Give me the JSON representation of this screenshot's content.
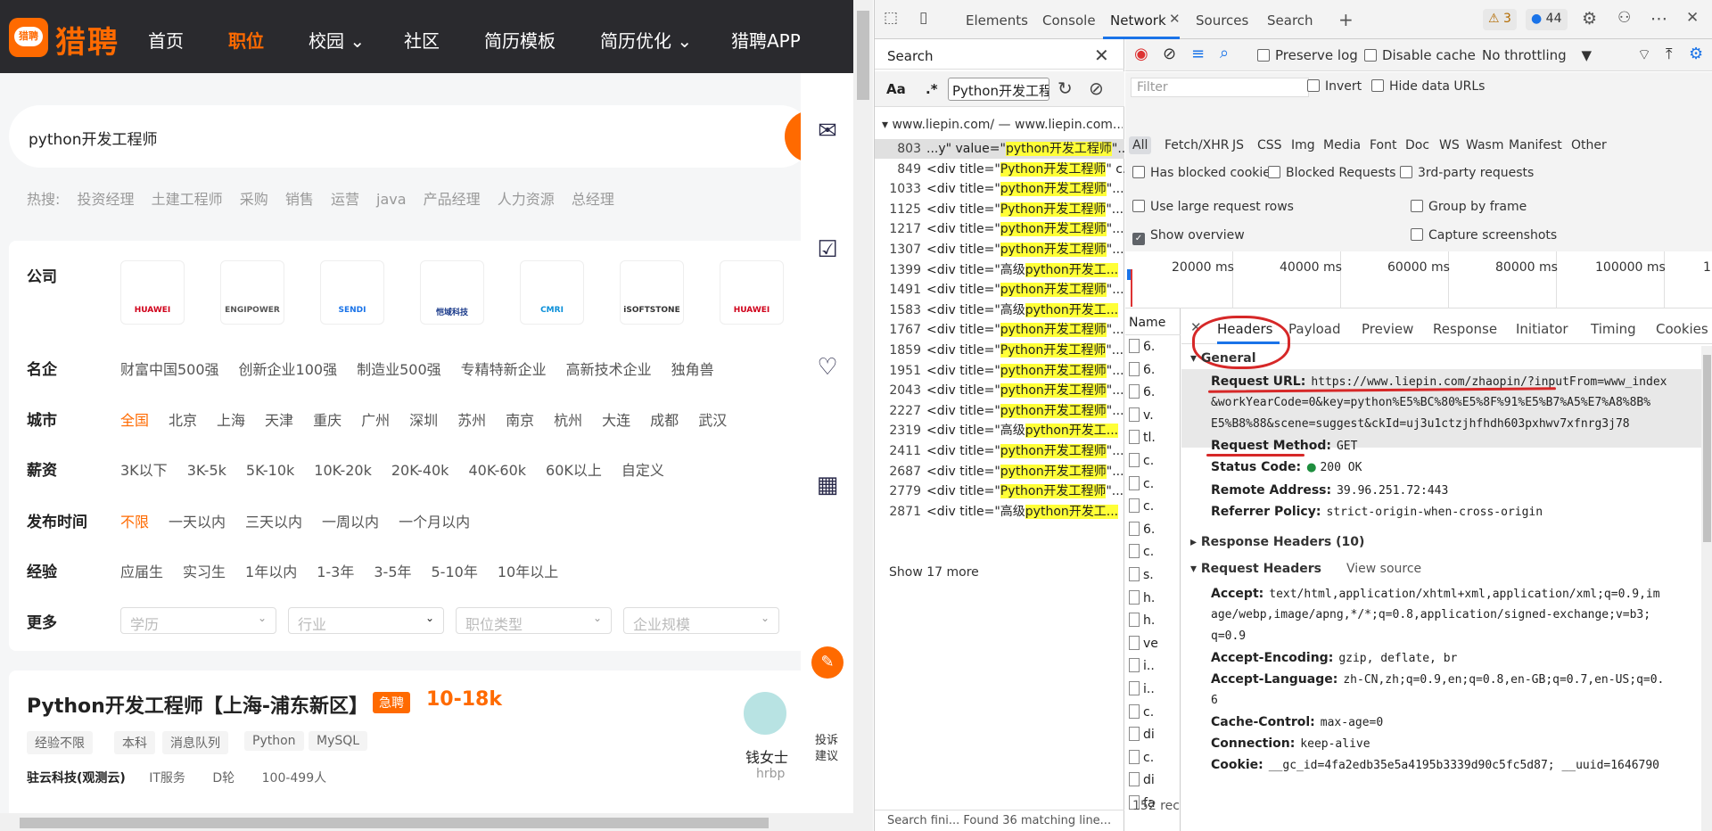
{
  "site": {
    "logo_badge": "猎聘",
    "logo_text": "猎聘",
    "nav": [
      "首页",
      "职位",
      "校园 ⌄",
      "社区",
      "简历模板",
      "简历优化 ⌄",
      "猎聘APP"
    ],
    "search_value": "python开发工程师",
    "hot_label": "热搜:",
    "hot_terms": [
      "投资经理",
      "土建工程师",
      "采购",
      "销售",
      "运营",
      "java",
      "产品经理",
      "人力资源",
      "总经理"
    ],
    "filters": {
      "company_label": "公司",
      "company_logos": [
        "HUAWEI",
        "ENGIPOWER",
        "SENDI",
        "恺域科技",
        "CMRI",
        "iSOFTSTONE",
        "HUAWEI"
      ],
      "famous_label": "名企",
      "famous": [
        "财富中国500强",
        "创新企业100强",
        "制造业500强",
        "专精特新企业",
        "高新技术企业",
        "独角兽"
      ],
      "city_label": "城市",
      "city": [
        "全国",
        "北京",
        "上海",
        "天津",
        "重庆",
        "广州",
        "深圳",
        "苏州",
        "南京",
        "杭州",
        "大连",
        "成都",
        "武汉"
      ],
      "salary_label": "薪资",
      "salary": [
        "3K以下",
        "3K-5k",
        "5K-10k",
        "10K-20k",
        "20K-40k",
        "40K-60k",
        "60K以上",
        "自定义"
      ],
      "time_label": "发布时间",
      "time": [
        "不限",
        "一天以内",
        "三天以内",
        "一周以内",
        "一个月以内"
      ],
      "exp_label": "经验",
      "exp": [
        "应届生",
        "实习生",
        "1年以内",
        "1-3年",
        "3-5年",
        "5-10年",
        "10年以上"
      ],
      "more_label": "更多",
      "more_dropdowns": [
        "学历",
        "行业",
        "职位类型",
        "企业规模"
      ]
    },
    "job": {
      "title": "Python开发工程师【上海-浦东新区】",
      "urgent": "急聘",
      "salary": "10-18k",
      "tags": [
        "经验不限",
        "本科",
        "消息队列",
        "Python",
        "MySQL"
      ],
      "company": "驻云科技(观测云)",
      "industry": "IT服务",
      "round": "D轮",
      "size": "100-499人",
      "recruiter": "钱女士",
      "recruiter_role": "hrbp"
    },
    "side_feedback": "投诉建议"
  },
  "devtools": {
    "tabs": [
      "Elements",
      "Console",
      "Network",
      "Sources",
      "Search"
    ],
    "active_tab": "Network",
    "warn_count": "3",
    "msg_count": "44",
    "search": {
      "title": "Search",
      "aa": "Aa",
      "regex": ".*",
      "query": "Python开发工程",
      "file": "www.liepin.com/ — www.liepin.com...",
      "lines": [
        {
          "n": "803",
          "pre": "...y\" value=\"",
          "hit": "python开发工程师",
          "post": "\"..."
        },
        {
          "n": "849",
          "pre": "<div title=\"",
          "hit": "Python开发工程师",
          "post": "\" c..."
        },
        {
          "n": "1033",
          "pre": "<div title=\"",
          "hit": "python开发工程师",
          "post": "\"..."
        },
        {
          "n": "1125",
          "pre": "<div title=\"",
          "hit": "Python开发工程师",
          "post": "\"..."
        },
        {
          "n": "1217",
          "pre": "<div title=\"",
          "hit": "python开发工程师",
          "post": "\"..."
        },
        {
          "n": "1307",
          "pre": "<div title=\"",
          "hit": "python开发工程师",
          "post": "\"..."
        },
        {
          "n": "1399",
          "pre": "<div title=\"高级",
          "hit": "python开发工...",
          "post": ""
        },
        {
          "n": "1491",
          "pre": "<div title=\"",
          "hit": "python开发工程师",
          "post": "\"..."
        },
        {
          "n": "1583",
          "pre": "<div title=\"高级",
          "hit": "python开发工...",
          "post": ""
        },
        {
          "n": "1767",
          "pre": "<div title=\"",
          "hit": "python开发工程师",
          "post": "\"..."
        },
        {
          "n": "1859",
          "pre": "<div title=\"",
          "hit": "Python开发工程师",
          "post": "\"..."
        },
        {
          "n": "1951",
          "pre": "<div title=\"",
          "hit": "python开发工程师",
          "post": "\"..."
        },
        {
          "n": "2043",
          "pre": "<div title=\"",
          "hit": "python开发工程师",
          "post": "\"..."
        },
        {
          "n": "2227",
          "pre": "<div title=\"",
          "hit": "python开发工程师",
          "post": "\"..."
        },
        {
          "n": "2319",
          "pre": "<div title=\"高级",
          "hit": "python开发工...",
          "post": ""
        },
        {
          "n": "2411",
          "pre": "<div title=\"",
          "hit": "python开发工程师",
          "post": "\"..."
        },
        {
          "n": "2687",
          "pre": "<div title=\"",
          "hit": "python开发工程师",
          "post": "\"..."
        },
        {
          "n": "2779",
          "pre": "<div title=\"",
          "hit": "Python开发工程师",
          "post": "\"..."
        },
        {
          "n": "2871",
          "pre": "<div title=\"高级",
          "hit": "python开发工...",
          "post": ""
        }
      ],
      "more": "Show 17 more",
      "status": "Search fini...   Found 36 matching line..."
    },
    "network": {
      "preserve_log": "Preserve log",
      "disable_cache": "Disable cache",
      "throttling": "No throttling",
      "filter_placeholder": "Filter",
      "invert": "Invert",
      "hide_data_urls": "Hide data URLs",
      "types": [
        "All",
        "Fetch/XHR",
        "JS",
        "CSS",
        "Img",
        "Media",
        "Font",
        "Doc",
        "WS",
        "Wasm",
        "Manifest",
        "Other"
      ],
      "has_blocked_cookies": "Has blocked cookies",
      "blocked_requests": "Blocked Requests",
      "third_party": "3rd-party requests",
      "large_rows": "Use large request rows",
      "group_by_frame": "Group by frame",
      "show_overview": "Show overview",
      "capture_screenshots": "Capture screenshots",
      "overview_ticks": [
        "20000 ms",
        "40000 ms",
        "60000 ms",
        "80000 ms",
        "100000 ms",
        "1"
      ],
      "name_header": "Name",
      "requests": [
        "6.",
        "6.",
        "6.",
        "v.",
        "tl.",
        "c.",
        "c.",
        "c.",
        "6.",
        "c.",
        "s.",
        "h.",
        "h.",
        "ve",
        "i..",
        "i..",
        "c.",
        "di",
        "c.",
        "di",
        "fa"
      ],
      "request_count": "152 rec",
      "detail_tabs": [
        "Headers",
        "Payload",
        "Preview",
        "Response",
        "Initiator",
        "Timing",
        "Cookies"
      ],
      "general_title": "General",
      "request_url_label": "Request URL:",
      "request_url_1": "https://www.liepin.com/zhaopin/?inputFrom=www_index",
      "request_url_2": "&workYearCode=0&key=python%E5%BC%80%E5%8F%91%E5%B7%A5%E7%A8%8B%",
      "request_url_3": "E5%B8%88&scene=suggest&ckId=uj3u1ctzjhfhdh603pxhwv7xfnrg3j78",
      "method_label": "Request Method:",
      "method": "GET",
      "status_label": "Status Code:",
      "status": "200 OK",
      "remote_label": "Remote Address:",
      "remote": "39.96.251.72:443",
      "referrer_label": "Referrer Policy:",
      "referrer": "strict-origin-when-cross-origin",
      "response_headers": "Response Headers (10)",
      "request_headers": "Request Headers",
      "view_source": "View source",
      "accept_label": "Accept:",
      "accept_1": "text/html,application/xhtml+xml,application/xml;q=0.9,im",
      "accept_2": "age/webp,image/apng,*/*;q=0.8,application/signed-exchange;v=b3;",
      "accept_3": "q=0.9",
      "accept_encoding_label": "Accept-Encoding:",
      "accept_encoding": "gzip, deflate, br",
      "accept_language_label": "Accept-Language:",
      "accept_language_1": "zh-CN,zh;q=0.9,en;q=0.8,en-GB;q=0.7,en-US;q=0.",
      "accept_language_2": "6",
      "cache_label": "Cache-Control:",
      "cache": "max-age=0",
      "connection_label": "Connection:",
      "connection": "keep-alive",
      "cookie_label": "Cookie:",
      "cookie": "__gc_id=4fa2edb35e5a4195b3339d90c5fc5d87; __uuid=1646790"
    }
  }
}
